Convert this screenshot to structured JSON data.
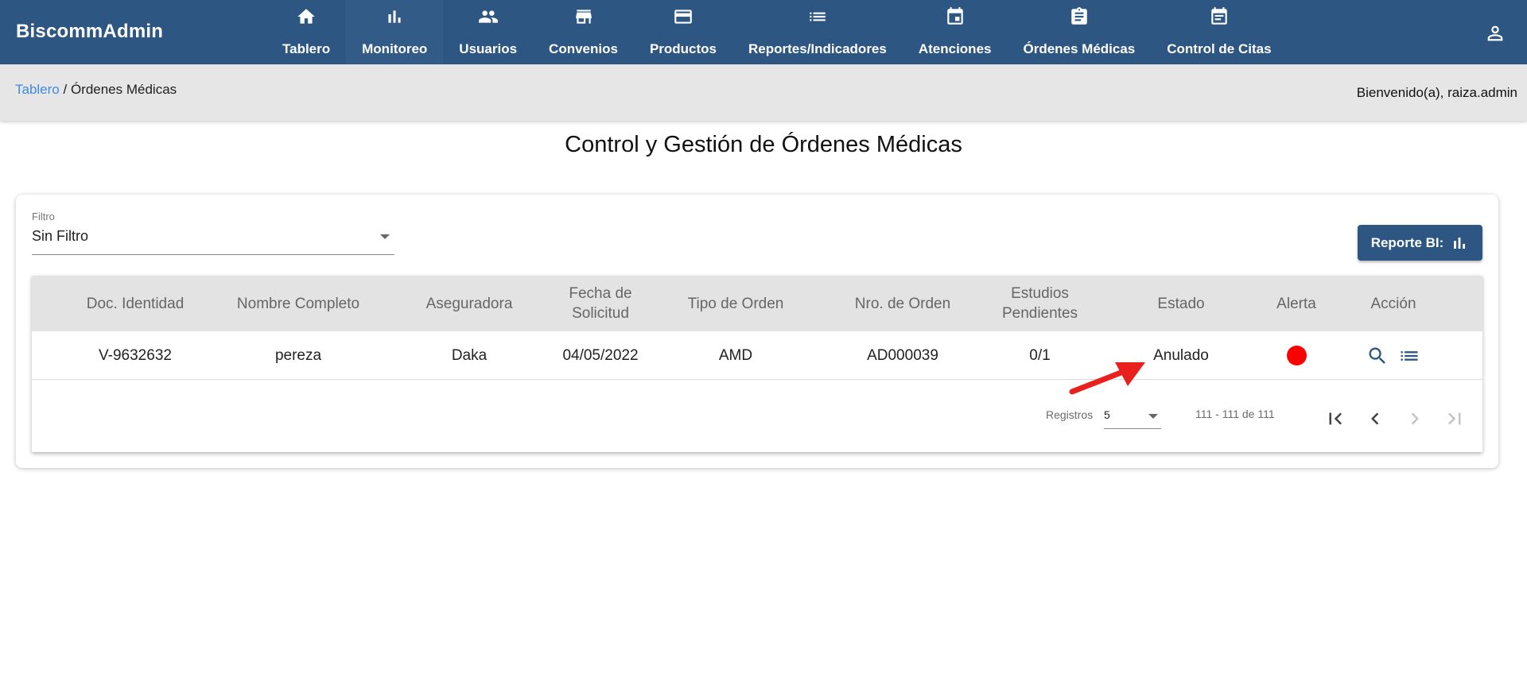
{
  "app": {
    "brand": "BiscommAdmin"
  },
  "nav": {
    "items": [
      {
        "label": "Tablero",
        "icon": "home-icon"
      },
      {
        "label": "Monitoreo",
        "icon": "bar-chart-icon"
      },
      {
        "label": "Usuarios",
        "icon": "people-icon"
      },
      {
        "label": "Convenios",
        "icon": "store-icon"
      },
      {
        "label": "Productos",
        "icon": "credit-card-icon"
      },
      {
        "label": "Reportes/Indicadores",
        "icon": "list-icon"
      },
      {
        "label": "Atenciones",
        "icon": "calendar-icon"
      },
      {
        "label": "Órdenes Médicas",
        "icon": "clipboard-icon"
      },
      {
        "label": "Control de Citas",
        "icon": "calendar-icon"
      }
    ],
    "active": "Monitoreo"
  },
  "breadcrumb": {
    "home": "Tablero",
    "separator": " / ",
    "current": "Órdenes Médicas"
  },
  "welcome": "Bienvenido(a), raiza.admin",
  "page_title": "Control y Gestión de Órdenes Médicas",
  "filter": {
    "label": "Filtro",
    "value": "Sin Filtro"
  },
  "report_button": {
    "label": "Reporte BI:"
  },
  "table": {
    "columns": [
      "Doc. Identidad",
      "Nombre Completo",
      "Aseguradora",
      "Fecha de Solicitud",
      "Tipo de Orden",
      "Nro. de Orden",
      "Estudios Pendientes",
      "Estado",
      "Alerta",
      "Acción"
    ],
    "rows": [
      {
        "doc": "V-9632632",
        "name": "pereza",
        "insurer": "Daka",
        "date": "04/05/2022",
        "type": "AMD",
        "order_no": "AD000039",
        "pending": "0/1",
        "status": "Anulado",
        "alert_color": "#ff0000"
      }
    ]
  },
  "pager": {
    "registros_label": "Registros",
    "page_size": "5",
    "range": "111 - 111 de 111"
  },
  "colors": {
    "primary": "#2d5682",
    "link": "#3f8ae0",
    "alert": "#ff0000",
    "annotation_arrow": "#e8211f"
  }
}
